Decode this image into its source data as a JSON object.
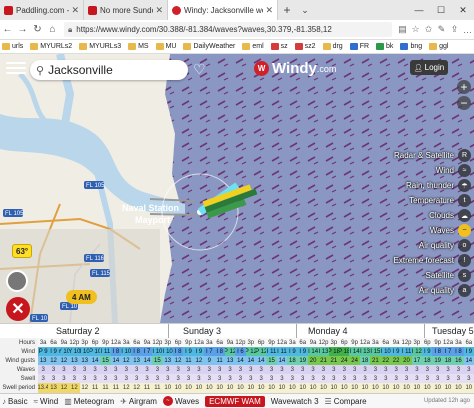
{
  "browser": {
    "tabs": [
      {
        "title": "Paddling.com - Paddling.c",
        "color": "#c8161e",
        "active": false
      },
      {
        "title": "No more Sundolphin, Evok",
        "color": "#c8161e",
        "active": false
      },
      {
        "title": "Windy: Jacksonville we",
        "color": "#d0202a",
        "active": true
      }
    ],
    "new_tab": "+",
    "url": "https://www.windy.com/30.388/-81.384/waves?waves,30.379,-81.358,12",
    "bookmarks": [
      "urls",
      "MYURLs2",
      "MYURLs3",
      "MS",
      "MU",
      "DailyWeather",
      "eml",
      "sz",
      "sz2",
      "drg",
      "FR",
      "bk",
      "bng",
      "ggl"
    ]
  },
  "map": {
    "search_value": "Jacksonville",
    "logo": "Windy",
    "logo_suffix": ".com",
    "login_label": "Login",
    "temp_label": "63°",
    "time_label": "4 AM",
    "zoom_in": "+",
    "zoom_out": "−",
    "places": {
      "naval_station": "Naval Station",
      "mayport": "Mayport",
      "highway_a": "FL 105",
      "highway_b": "FL 105",
      "highway_c": "FL 116",
      "highway_d": "FL 115",
      "highway_e": "FL 10",
      "highway_f": "FL 10"
    },
    "layers": [
      {
        "label": "Radar & Satellite",
        "icon": "R",
        "active": false
      },
      {
        "label": "Wind",
        "icon": "≈",
        "active": false
      },
      {
        "label": "Rain, thunder",
        "icon": "☂",
        "active": false
      },
      {
        "label": "Temperature",
        "icon": "t",
        "active": false
      },
      {
        "label": "Clouds",
        "icon": "☁",
        "active": false
      },
      {
        "label": "Waves",
        "icon": "~",
        "active": true
      },
      {
        "label": "Air quality",
        "icon": "o",
        "active": false
      },
      {
        "label": "Extreme forecast",
        "icon": "!",
        "active": false
      },
      {
        "label": "Satellite",
        "icon": "s",
        "active": false
      },
      {
        "label": "Air quality",
        "icon": "a",
        "active": false
      }
    ]
  },
  "forecast": {
    "days": [
      "Saturday 2",
      "Sunday 3",
      "Monday 4",
      "Tuesday 5"
    ],
    "row_labels": [
      "Hours",
      "Wind",
      "Wind gusts",
      "Waves",
      "Swell",
      "Swell period"
    ],
    "hours": [
      "3a",
      "6a",
      "9a",
      "12p",
      "3p",
      "6p",
      "9p",
      "12a",
      "3a",
      "6a",
      "9a",
      "12p",
      "3p",
      "6p",
      "9p",
      "12a",
      "3a",
      "6a",
      "9a",
      "12p",
      "3p",
      "6p",
      "9p",
      "12a",
      "3a",
      "6a",
      "9a",
      "12p",
      "3p",
      "6p",
      "9p",
      "12a",
      "3a",
      "6a",
      "9a",
      "12p",
      "3p",
      "6p",
      "9p",
      "12a",
      "3a",
      "6a"
    ],
    "wind": [
      "P 9",
      "I 9",
      "Y 10",
      "Y 10",
      "I 10",
      "P 10",
      "I 11",
      "I 8",
      "I 10",
      "I 8",
      "I 7",
      "I 10",
      "I 10",
      "I 8",
      "I 9",
      "I 9",
      "I 7",
      "I 8",
      "P 12",
      "I 6",
      "P 12",
      "P 12",
      "I 11",
      "I 11",
      "I 9",
      "I 9",
      "I 14",
      "I 13",
      "P 18",
      "P 18",
      "I 14",
      "I 13",
      "I 15",
      "I 10",
      "I 9",
      "I 11",
      "I 12",
      "I 9",
      "I 8",
      "I 7",
      "I 8",
      "I 9"
    ],
    "gusts": [
      "13",
      "12",
      "12",
      "13",
      "13",
      "14",
      "15",
      "14",
      "12",
      "13",
      "14",
      "15",
      "13",
      "12",
      "11",
      "12",
      "9",
      "11",
      "13",
      "14",
      "14",
      "14",
      "15",
      "14",
      "18",
      "19",
      "20",
      "21",
      "21",
      "24",
      "24",
      "18",
      "21",
      "22",
      "22",
      "20",
      "17",
      "18",
      "19",
      "18",
      "16",
      "14"
    ],
    "waves": [
      "3",
      "3",
      "3",
      "3",
      "3",
      "3",
      "3",
      "3",
      "3",
      "3",
      "3",
      "3",
      "3",
      "3",
      "3",
      "3",
      "3",
      "3",
      "3",
      "3",
      "3",
      "3",
      "3",
      "3",
      "3",
      "3",
      "3",
      "3",
      "3",
      "3",
      "3",
      "3",
      "3",
      "3",
      "3",
      "3",
      "3",
      "3",
      "3",
      "3",
      "3",
      "3"
    ],
    "swell": [
      "3",
      "3",
      "3",
      "3",
      "3",
      "3",
      "3",
      "3",
      "3",
      "3",
      "3",
      "3",
      "3",
      "3",
      "3",
      "3",
      "3",
      "3",
      "3",
      "3",
      "3",
      "3",
      "3",
      "3",
      "3",
      "3",
      "3",
      "3",
      "3",
      "3",
      "3",
      "3",
      "3",
      "3",
      "3",
      "3",
      "3",
      "3",
      "3",
      "3",
      "3",
      "3"
    ],
    "swell_period": [
      "13.4",
      "13",
      "12",
      "12",
      "12",
      "11",
      "11",
      "11",
      "12",
      "12",
      "11",
      "11",
      "10",
      "10",
      "10",
      "10",
      "10",
      "10",
      "10",
      "10",
      "10",
      "10",
      "10",
      "10",
      "10",
      "10",
      "10",
      "10",
      "10",
      "10",
      "10",
      "10",
      "10",
      "10",
      "10",
      "10",
      "10",
      "10",
      "10",
      "10",
      "10",
      "10"
    ]
  },
  "toolbar": {
    "items": [
      {
        "label": "Basic",
        "icon": "♪",
        "active": false,
        "model": false
      },
      {
        "label": "Wind",
        "icon": "≈",
        "active": false,
        "model": false
      },
      {
        "label": "Meteogram",
        "icon": "▥",
        "active": false,
        "model": false
      },
      {
        "label": "Airgram",
        "icon": "✈",
        "active": false,
        "model": false
      },
      {
        "label": "Waves",
        "icon": "~",
        "active": true,
        "model": false
      },
      {
        "label": "ECMWF WAM",
        "icon": "",
        "active": false,
        "model": true
      },
      {
        "label": "Wavewatch 3",
        "icon": "",
        "active": false,
        "model": false
      },
      {
        "label": "Compare",
        "icon": "☰",
        "active": false,
        "model": false
      }
    ],
    "updated": "Updated 12h ago"
  },
  "colors": {
    "ocean": "#8a97c2",
    "land": "#f0ede4",
    "water_inland": "#b9d6ea",
    "accent": "#d0202a",
    "highlight": "#f0c020"
  }
}
